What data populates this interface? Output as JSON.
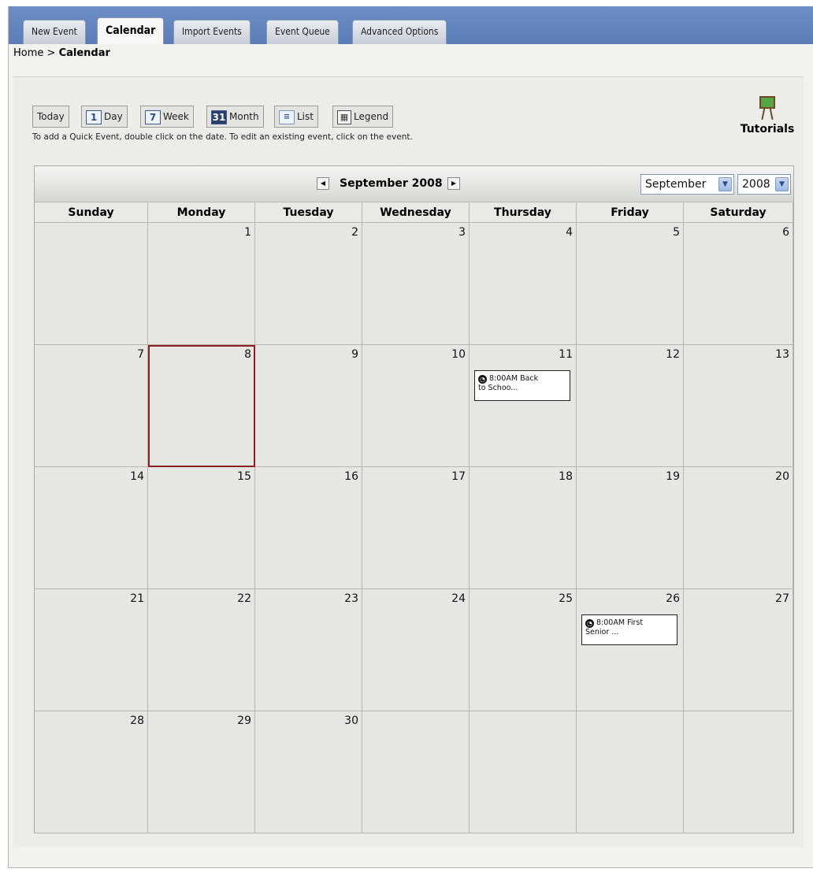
{
  "tabs": [
    {
      "label": "New Event"
    },
    {
      "label": "Calendar"
    },
    {
      "label": "Import Events"
    },
    {
      "label": "Event Queue"
    },
    {
      "label": "Advanced Options"
    }
  ],
  "breadcrumb": {
    "home": "Home",
    "separator": ">",
    "current": "Calendar"
  },
  "toolbar": {
    "today": "Today",
    "day": "Day",
    "day_icon": "1",
    "week": "Week",
    "week_icon": "7",
    "month": "Month",
    "month_icon": "31",
    "list": "List",
    "list_icon": "≡",
    "legend": "Legend",
    "legend_icon": "▦"
  },
  "hint": "To add a Quick Event, double click on the date. To edit an existing event, click on the event.",
  "tutorials": {
    "label": "Tutorials",
    "icon": "easel-icon"
  },
  "calendar": {
    "title": "September 2008",
    "prev_icon": "◀",
    "next_icon": "▶",
    "month_select": "September",
    "year_select": "2008",
    "weekdays": [
      "Sunday",
      "Monday",
      "Tuesday",
      "Wednesday",
      "Thursday",
      "Friday",
      "Saturday"
    ],
    "weeks": [
      [
        "",
        "1",
        "2",
        "3",
        "4",
        "5",
        "6"
      ],
      [
        "7",
        "8",
        "9",
        "10",
        "11",
        "12",
        "13"
      ],
      [
        "14",
        "15",
        "16",
        "17",
        "18",
        "19",
        "20"
      ],
      [
        "21",
        "22",
        "23",
        "24",
        "25",
        "26",
        "27"
      ],
      [
        "28",
        "29",
        "30",
        "",
        "",
        "",
        ""
      ]
    ],
    "selected_day": "8",
    "events": [
      {
        "day": "11",
        "time": "8:00AM",
        "text_line1": "Back",
        "text_line2": "to Schoo...",
        "icon": "clock-icon"
      },
      {
        "day": "26",
        "time": "8:00AM",
        "text_line1": "First",
        "text_line2": "Senior ...",
        "icon": "clock-icon"
      }
    ],
    "colors": {
      "selected_border": "#8e1d1d",
      "tab_bar": "#5b7db8"
    }
  }
}
